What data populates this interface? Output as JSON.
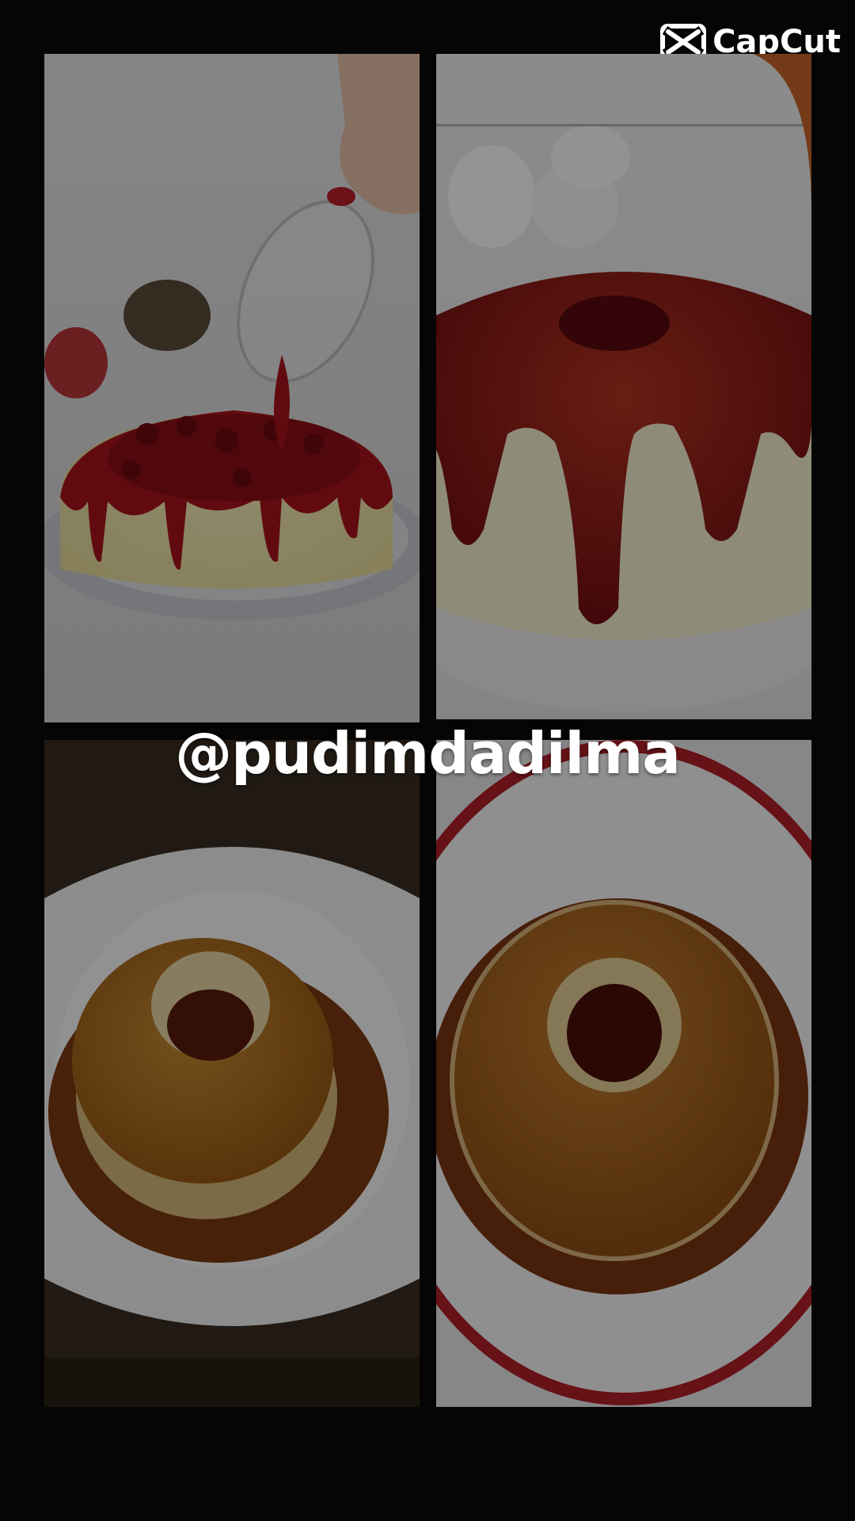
{
  "watermark": {
    "brand_name": "CapCut",
    "logo_icon": "capcut-logo-icon"
  },
  "overlay": {
    "handle_text": "@pudimdadilma"
  },
  "tiles": [
    {
      "subject": "pudding-with-berry-sauce-pour-image"
    },
    {
      "subject": "pudding-with-red-glaze-image"
    },
    {
      "subject": "caramel-pudding-on-plate-image"
    },
    {
      "subject": "caramel-pudding-top-view-image"
    }
  ],
  "colors": {
    "background": "#050505",
    "text": "#ffffff",
    "caramel": "#8a4a12",
    "berry": "#7a0d12"
  }
}
